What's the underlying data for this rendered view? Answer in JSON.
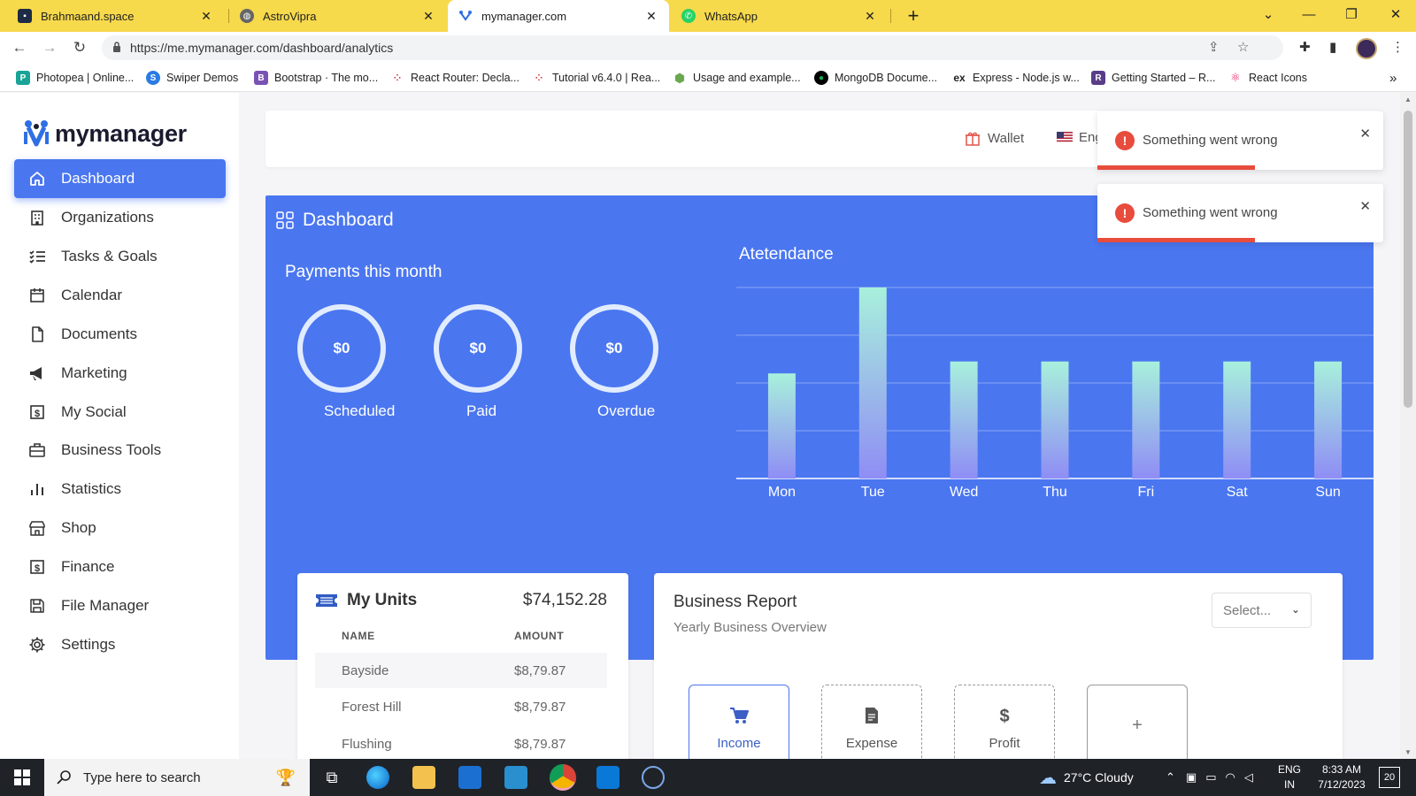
{
  "browser": {
    "tabs": [
      {
        "title": "Brahmaand.space",
        "icon": "brahmaand-favicon"
      },
      {
        "title": "AstroVipra",
        "icon": "globe-icon"
      },
      {
        "title": "mymanager.com",
        "icon": "mymanager-favicon"
      },
      {
        "title": "WhatsApp",
        "icon": "whatsapp-icon"
      }
    ],
    "active_tab": 2,
    "url": "https://me.mymanager.com/dashboard/analytics",
    "bookmarks": [
      {
        "label": "Photopea | Online...",
        "icon": "photopea-icon",
        "color": "#18a497"
      },
      {
        "label": "Swiper Demos",
        "icon": "swiper-icon",
        "color": "#2a7be4"
      },
      {
        "label": "Bootstrap · The mo...",
        "icon": "bootstrap-icon",
        "color": "#7952b3"
      },
      {
        "label": "React Router: Decla...",
        "icon": "react-router-icon",
        "color": "#c9242b"
      },
      {
        "label": "Tutorial v6.4.0 | Rea...",
        "icon": "react-router-icon",
        "color": "#c9242b"
      },
      {
        "label": "Usage and example...",
        "icon": "hexagon-icon",
        "color": "#6aa84f"
      },
      {
        "label": "MongoDB Docume...",
        "icon": "mongodb-icon",
        "color": "#13aa52"
      },
      {
        "label": "Express - Node.js w...",
        "icon": "express-icon",
        "color": "#222222"
      },
      {
        "label": "Getting Started – R...",
        "icon": "redux-icon",
        "color": "#593d88"
      },
      {
        "label": "React Icons",
        "icon": "react-icon",
        "color": "#e91e63"
      }
    ],
    "more_bookmarks": "»"
  },
  "app": {
    "logo": "mymanager",
    "sidebar": [
      {
        "label": "Dashboard",
        "icon": "home-icon",
        "active": true
      },
      {
        "label": "Organizations",
        "icon": "building-icon"
      },
      {
        "label": "Tasks & Goals",
        "icon": "checklist-icon"
      },
      {
        "label": "Calendar",
        "icon": "calendar-icon"
      },
      {
        "label": "Documents",
        "icon": "document-icon"
      },
      {
        "label": "Marketing",
        "icon": "megaphone-icon"
      },
      {
        "label": "My Social",
        "icon": "dollar-square-icon"
      },
      {
        "label": "Business Tools",
        "icon": "briefcase-icon"
      },
      {
        "label": "Statistics",
        "icon": "bar-chart-icon"
      },
      {
        "label": "Shop",
        "icon": "store-icon"
      },
      {
        "label": "Finance",
        "icon": "dollar-square-icon"
      },
      {
        "label": "File Manager",
        "icon": "save-icon"
      },
      {
        "label": "Settings",
        "icon": "gear-icon"
      }
    ],
    "topbar": {
      "wallet": "Wallet",
      "language": "Eng"
    },
    "toasts": [
      "Something went wrong",
      "Something went wrong"
    ],
    "dashboard": {
      "title": "Dashboard",
      "payments_title": "Payments this month",
      "payments": [
        {
          "value": "$0",
          "label": "Scheduled"
        },
        {
          "value": "$0",
          "label": "Paid"
        },
        {
          "value": "$0",
          "label": "Overdue"
        }
      ],
      "attendance_title": "Atetendance"
    },
    "units": {
      "title": "My Units",
      "total": "$74,152.28",
      "columns": [
        "NAME",
        "AMOUNT"
      ],
      "rows": [
        {
          "name": "Bayside",
          "amount": "$8,79.87"
        },
        {
          "name": "Forest Hill",
          "amount": "$8,79.87"
        },
        {
          "name": "Flushing",
          "amount": "$8,79.87"
        }
      ]
    },
    "report": {
      "title": "Business Report",
      "subtitle": "Yearly Business Overview",
      "select_placeholder": "Select...",
      "kpis": [
        {
          "label": "Income",
          "icon": "cart-icon"
        },
        {
          "label": "Expense",
          "icon": "receipt-icon"
        },
        {
          "label": "Profit",
          "icon": "dollar-icon"
        },
        {
          "label": "",
          "icon": "plus-icon",
          "glyph": "+"
        }
      ]
    },
    "colors": {
      "brand": "#4a76f0",
      "error": "#e74c3c",
      "tabbar": "#f7d94c"
    }
  },
  "chart_data": {
    "type": "bar",
    "title": "Atetendance",
    "categories": [
      "Mon",
      "Tue",
      "Wed",
      "Thu",
      "Fri",
      "Sat",
      "Sun"
    ],
    "values": [
      22,
      40,
      24.5,
      24.5,
      24.5,
      24.5,
      24.5
    ],
    "ylim": [
      0,
      40
    ],
    "grid": true
  },
  "taskbar": {
    "search_placeholder": "Type here to search",
    "weather": "27°C  Cloudy",
    "lang": "ENG",
    "region": "IN",
    "time": "8:33 AM",
    "date": "7/12/2023",
    "notifications": "20"
  }
}
